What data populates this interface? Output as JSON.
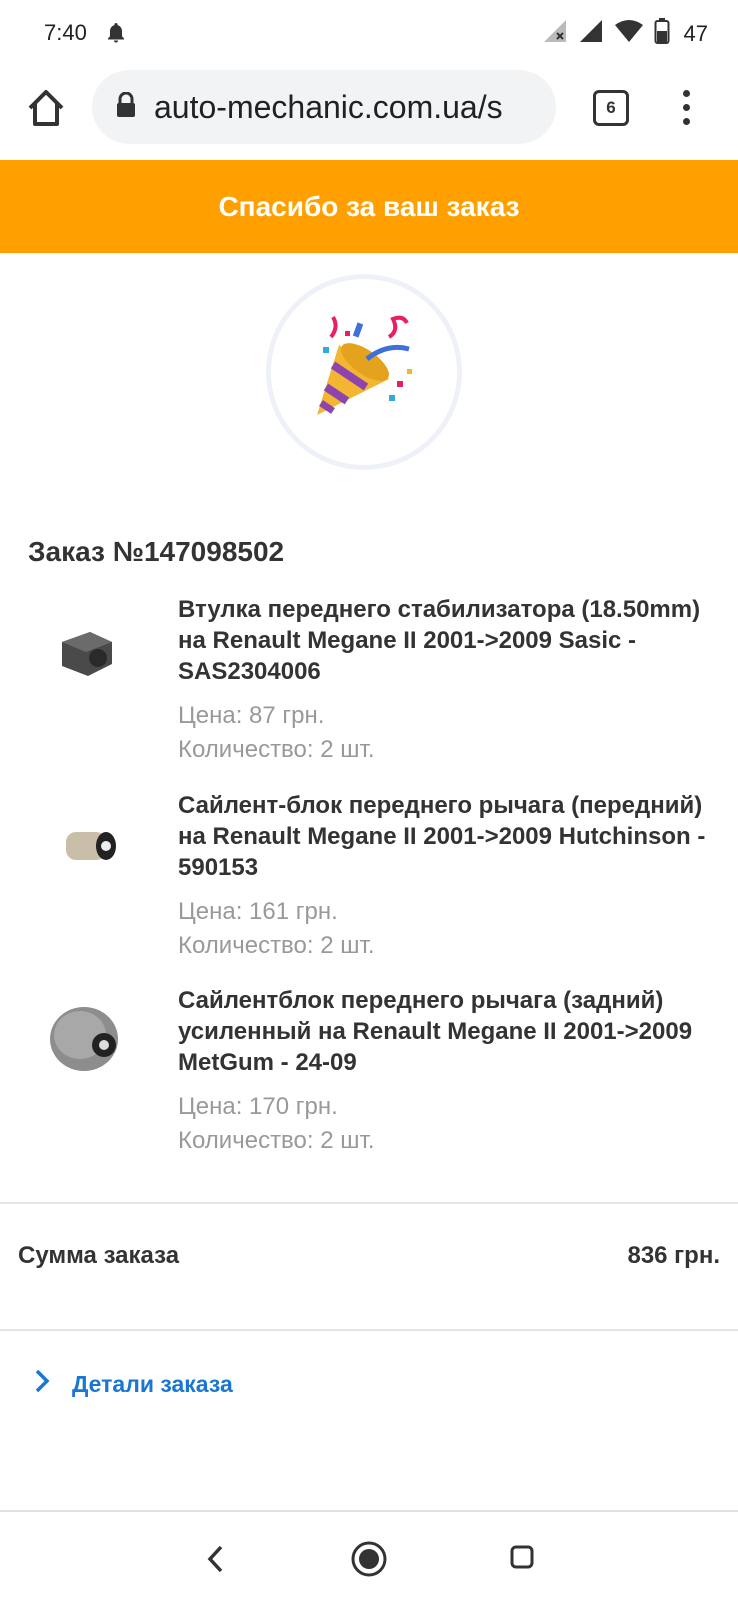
{
  "status_bar": {
    "time": "7:40",
    "battery": "47"
  },
  "browser": {
    "url": "auto-mechanic.com.ua/s",
    "tab_count": "6"
  },
  "banner": {
    "title": "Спасибо за ваш заказ"
  },
  "order": {
    "title": "Заказ №147098502",
    "items": [
      {
        "name": "Втулка переднего стабилизатора (18.50mm) на Renault Megane II 2001->2009 Sasic - SAS2304006",
        "price": "Цена: 87 грн.",
        "qty": "Количество: 2 шт."
      },
      {
        "name": "Сайлент-блок переднего рычага (передний) на Renault Megane II 2001->2009 Hutchinson - 590153",
        "price": "Цена: 161 грн.",
        "qty": "Количество: 2 шт."
      },
      {
        "name": "Сайлентблок переднего рычага (задний) усиленный на Renault Megane II 2001->2009 MetGum - 24-09",
        "price": "Цена: 170 грн.",
        "qty": "Количество: 2 шт."
      }
    ],
    "sum_label": "Сумма заказа",
    "sum_value": "836 грн.",
    "details_link": "Детали заказа"
  },
  "colors": {
    "accent": "#ffa000",
    "link": "#1976d2",
    "muted": "#999999"
  },
  "icons": {
    "bell": "bell-icon",
    "signal": "signal-icon",
    "wifi": "wifi-icon",
    "battery": "battery-icon",
    "home": "home-icon",
    "lock": "lock-icon",
    "menu": "more-vert-icon",
    "party": "party-popper-icon",
    "chevron": "chevron-right-icon",
    "nav_back": "back-icon",
    "nav_home": "home-circle-icon",
    "nav_recent": "recent-apps-icon"
  }
}
